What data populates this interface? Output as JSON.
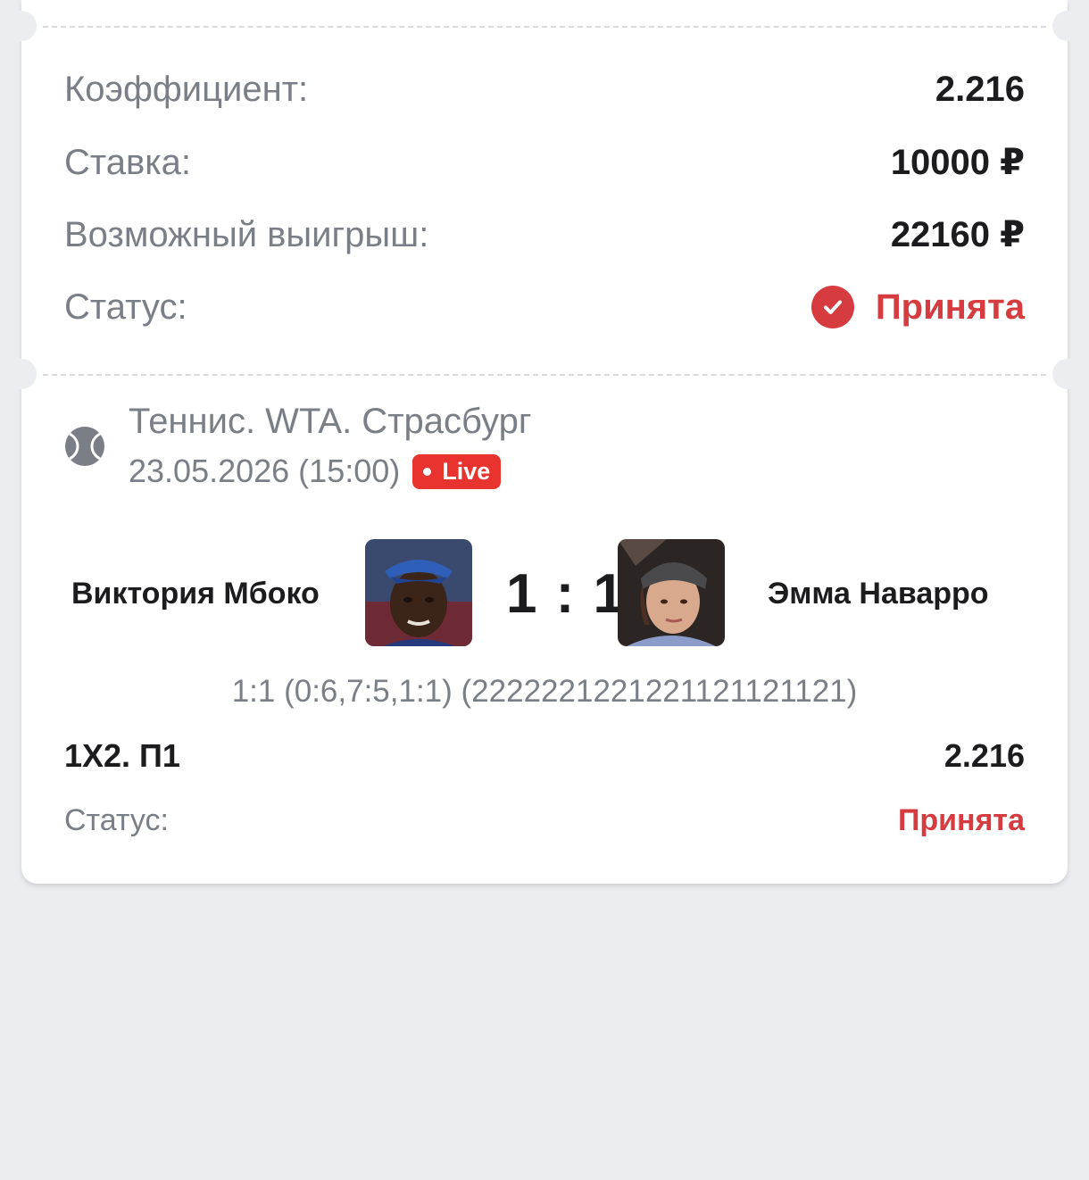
{
  "summary": {
    "coef_label": "Коэффициент:",
    "coef_value": "2.216",
    "stake_label": "Ставка:",
    "stake_value": "10000 ₽",
    "win_label": "Возможный выигрыш:",
    "win_value": "22160 ₽",
    "status_label": "Статус:",
    "status_value": "Принята"
  },
  "event": {
    "title": "Теннис. WTA. Страсбург",
    "datetime": "23.05.2026 (15:00)",
    "live_badge": "Live",
    "sport_icon": "tennis-ball-icon"
  },
  "match": {
    "home_player": "Виктория Мбоко",
    "away_player": "Эмма Наварро",
    "score": "1 : 1",
    "detail": "1:1 (0:6,7:5,1:1) (2222221221221121121121)"
  },
  "selection": {
    "market": "1X2. П1",
    "odds": "2.216",
    "status_label": "Статус:",
    "status_value": "Принята"
  },
  "colors": {
    "accent_red": "#d63b3f",
    "live_red": "#e8332f",
    "muted_text": "#7a7f87",
    "background": "#ecedf0"
  }
}
